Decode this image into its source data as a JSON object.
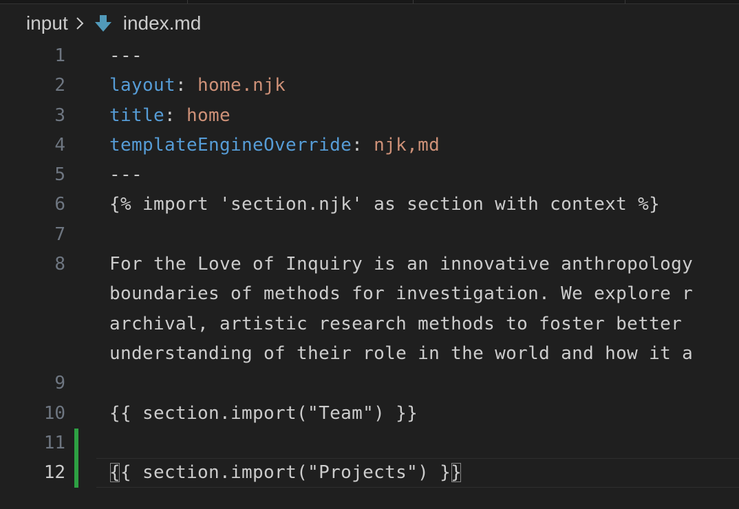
{
  "breadcrumb": {
    "folder": "input",
    "file": "index.md",
    "file_icon": "markdown-down-arrow-icon",
    "separator_icon": "chevron-right-icon"
  },
  "colors": {
    "background": "#1f1f1f",
    "key": "#569cd6",
    "value": "#ce9178",
    "text": "#cccccc",
    "line_number": "#6e7681",
    "git_added": "#2ea043"
  },
  "editor": {
    "current_line": 12,
    "lines": [
      {
        "number": "1",
        "text": "---"
      },
      {
        "number": "2",
        "key": "layout",
        "value": "home.njk"
      },
      {
        "number": "3",
        "key": "title",
        "value": "home"
      },
      {
        "number": "4",
        "key": "templateEngineOverride",
        "value": "njk,md"
      },
      {
        "number": "5",
        "text": "---"
      },
      {
        "number": "6",
        "text": "{% import 'section.njk' as section with context %}"
      },
      {
        "number": "7",
        "text": ""
      },
      {
        "number": "8",
        "wrapped": [
          "For the Love of Inquiry is an innovative anthropology",
          "boundaries of methods for investigation. We explore r",
          "archival, artistic research methods to foster better ",
          "understanding of their role in the world and how it a"
        ]
      },
      {
        "number": "9",
        "text": ""
      },
      {
        "number": "10",
        "text": "{{ section.import(\"Team\") }}"
      },
      {
        "number": "11",
        "text": ""
      },
      {
        "number": "12",
        "open_brace": "{",
        "middle": "{ section.import(\"Projects\") }",
        "close_brace": "}"
      }
    ]
  }
}
